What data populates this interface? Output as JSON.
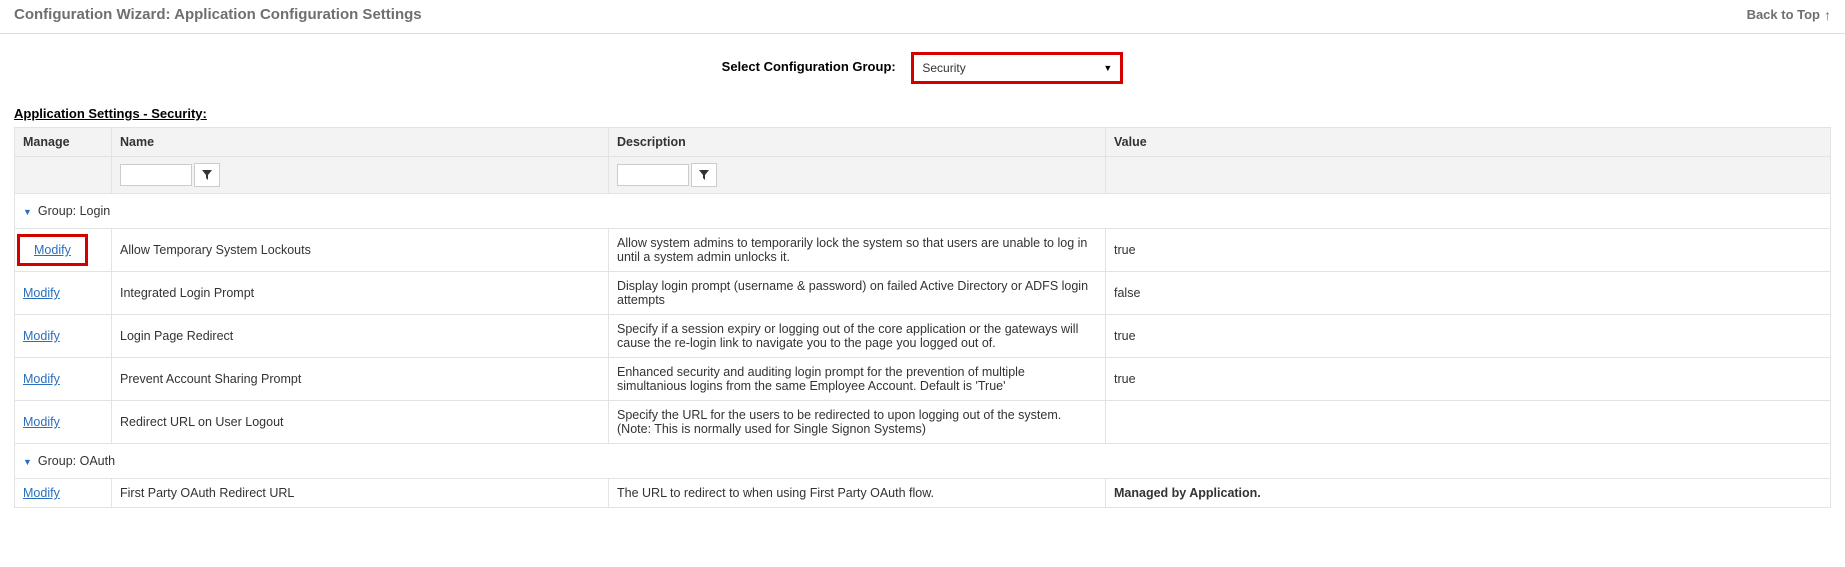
{
  "header": {
    "title": "Configuration Wizard: Application Configuration Settings",
    "back_to_top": "Back to Top"
  },
  "selector": {
    "label": "Select Configuration Group:",
    "value": "Security"
  },
  "section_title": "Application Settings - Security:",
  "columns": {
    "manage": "Manage",
    "name": "Name",
    "description": "Description",
    "value": "Value"
  },
  "groups": [
    {
      "label": "Group: Login",
      "rows": [
        {
          "modify": "Modify",
          "highlight": true,
          "name": "Allow Temporary System Lockouts",
          "description": "Allow system admins to temporarily lock the system so that users are unable to log in until a system admin unlocks it.",
          "value": "true"
        },
        {
          "modify": "Modify",
          "highlight": false,
          "name": "Integrated Login Prompt",
          "description": "Display login prompt (username & password) on failed Active Directory or ADFS login attempts",
          "value": "false"
        },
        {
          "modify": "Modify",
          "highlight": false,
          "name": "Login Page Redirect",
          "description": "Specify if a session expiry or logging out of the core application or the gateways will cause the re-login link to navigate you to the page you logged out of.",
          "value": "true"
        },
        {
          "modify": "Modify",
          "highlight": false,
          "name": "Prevent Account Sharing Prompt",
          "description": "Enhanced security and auditing login prompt for the prevention of multiple simultanious logins from the same Employee Account. Default is 'True'",
          "value": "true"
        },
        {
          "modify": "Modify",
          "highlight": false,
          "name": "Redirect URL on User Logout",
          "description": "Specify the URL for the users to be redirected to upon logging out of the system. (Note: This is normally used for Single Signon Systems)",
          "value": ""
        }
      ]
    },
    {
      "label": "Group: OAuth",
      "rows": [
        {
          "modify": "Modify",
          "highlight": false,
          "name": "First Party OAuth Redirect URL",
          "description": "The URL to redirect to when using First Party OAuth flow.",
          "value": "Managed by Application.",
          "value_bold": true
        }
      ]
    }
  ]
}
